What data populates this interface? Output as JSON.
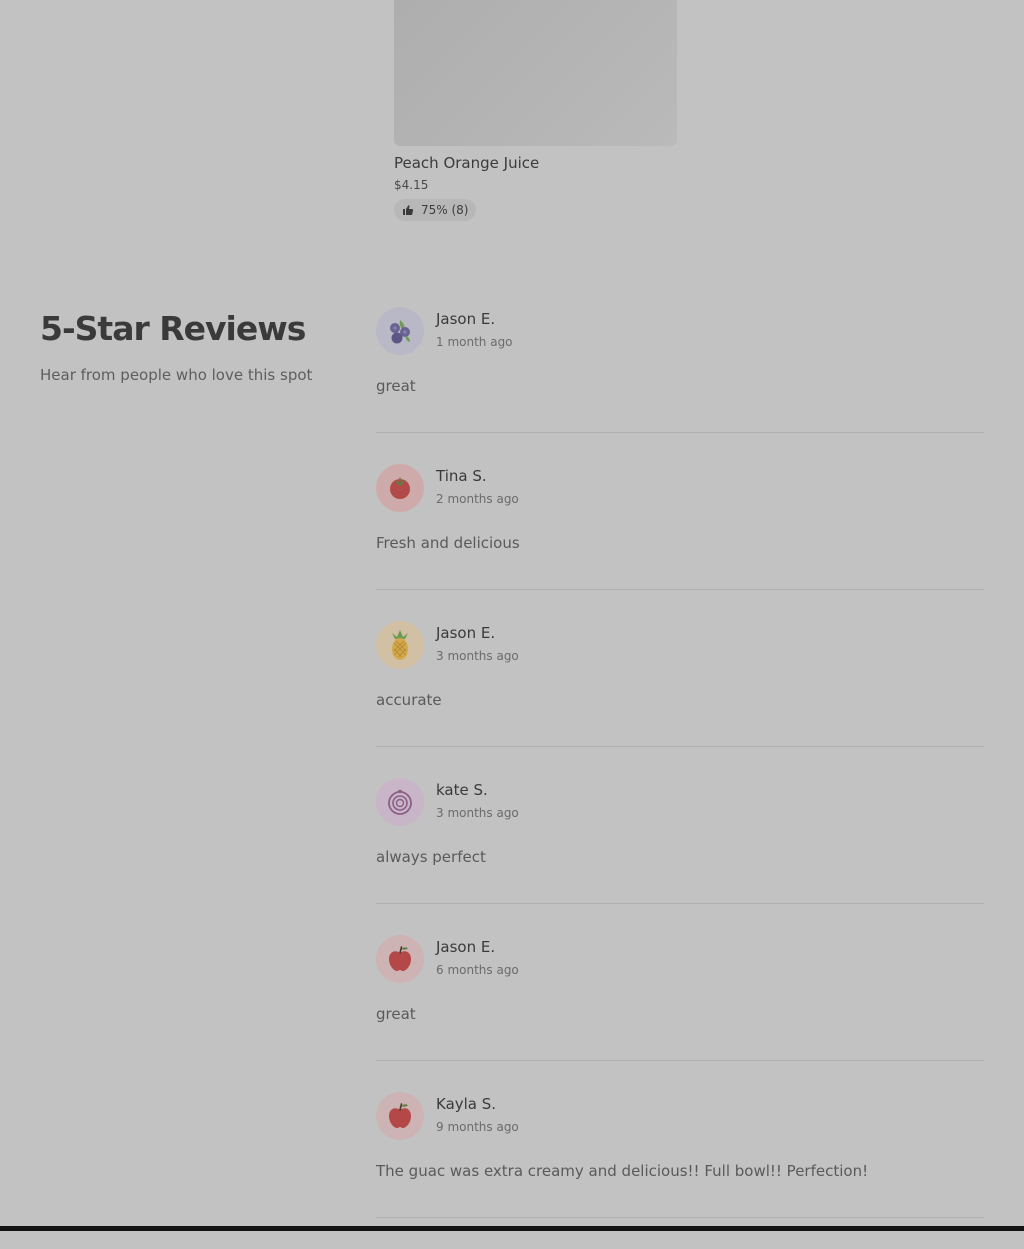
{
  "product": {
    "name": "Peach Orange Juice",
    "price": "$4.15",
    "rating": "75% (8)"
  },
  "reviews_section": {
    "title": "5-Star Reviews",
    "subtitle": "Hear from people who love this spot",
    "items": [
      {
        "name": "Jason E.",
        "date": "1 month ago",
        "text": "great",
        "avatar_icon": "blueberries-icon",
        "avatar_bg": "#b9b8c7"
      },
      {
        "name": "Tina S.",
        "date": "2 months ago",
        "text": "Fresh and delicious",
        "avatar_icon": "tomato-icon",
        "avatar_bg": "#cfaaaa"
      },
      {
        "name": "Jason E.",
        "date": "3 months ago",
        "text": "accurate",
        "avatar_icon": "pineapple-icon",
        "avatar_bg": "#d1c0a3"
      },
      {
        "name": "kate S.",
        "date": "3 months ago",
        "text": "always perfect",
        "avatar_icon": "onion-icon",
        "avatar_bg": "#c8b6c8"
      },
      {
        "name": "Jason E.",
        "date": "6 months ago",
        "text": "great",
        "avatar_icon": "apple-icon",
        "avatar_bg": "#cdb3b3"
      },
      {
        "name": "Kayla S.",
        "date": "9 months ago",
        "text": "The guac was extra creamy and delicious!! Full bowl!! Perfection!",
        "avatar_icon": "apple-icon",
        "avatar_bg": "#cdb3b3"
      }
    ]
  },
  "colors": {
    "page_background": "#c2c2c2",
    "divider": "#b0b0b0",
    "bottom_bar": "#141414"
  }
}
